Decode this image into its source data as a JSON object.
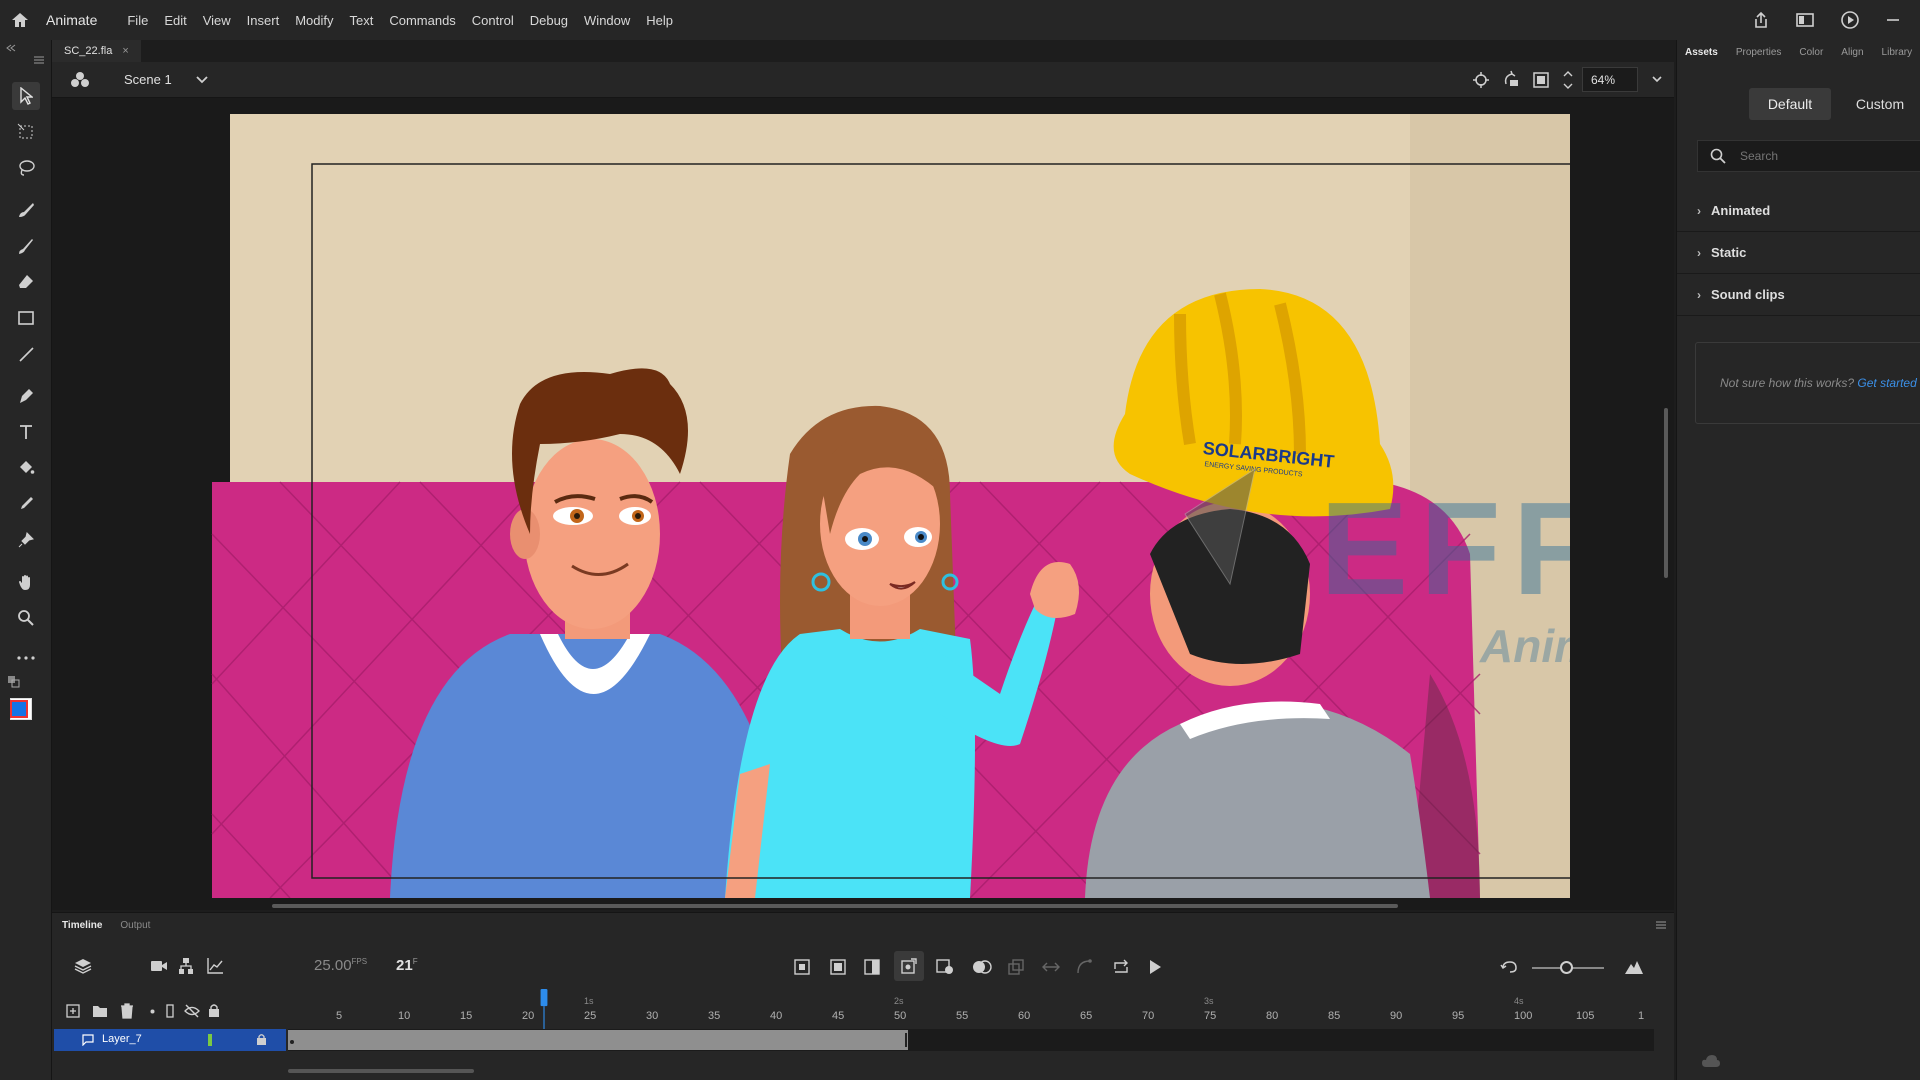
{
  "app": {
    "name": "Animate"
  },
  "menu": [
    "File",
    "Edit",
    "View",
    "Insert",
    "Modify",
    "Text",
    "Commands",
    "Control",
    "Debug",
    "Window",
    "Help"
  ],
  "document": {
    "tab_label": "SC_22.fla",
    "close_glyph": "×"
  },
  "scene": {
    "name": "Scene 1"
  },
  "zoom": {
    "value": "64%"
  },
  "stage_art": {
    "hat_logo_main": "SOLARBRIGHT",
    "hat_logo_sub": "ENERGY SAVING PRODUCTS",
    "watermark_main": "EFFE",
    "watermark_sub": "Animation"
  },
  "right_panel": {
    "tabs": [
      "Assets",
      "Properties",
      "Color",
      "Align",
      "Library"
    ],
    "active_tab": "Assets",
    "segment": {
      "default": "Default",
      "custom": "Custom"
    },
    "search_placeholder": "Search",
    "sections": [
      "Animated",
      "Static",
      "Sound clips"
    ],
    "hint_text": "Not sure how this works?",
    "hint_link": "Get started"
  },
  "timeline": {
    "tabs": [
      "Timeline",
      "Output"
    ],
    "fps": "25.00",
    "fps_unit": "FPS",
    "current_frame": "21",
    "frame_unit": "F",
    "layer_name": "Layer_7",
    "ruler_ticks": [
      "5",
      "10",
      "15",
      "20",
      "25",
      "30",
      "35",
      "40",
      "45",
      "50",
      "55",
      "60",
      "65",
      "70",
      "75",
      "80",
      "85",
      "90",
      "95",
      "100",
      "105",
      "1"
    ],
    "seconds_marks": [
      "1s",
      "2s",
      "3s",
      "4s"
    ]
  },
  "colors": {
    "accent_blue": "#1473e6",
    "stroke_color": "#ffffff",
    "fill_color": "#1473e6",
    "sofa": "#d12a86",
    "hard_hat": "#f7c300"
  }
}
